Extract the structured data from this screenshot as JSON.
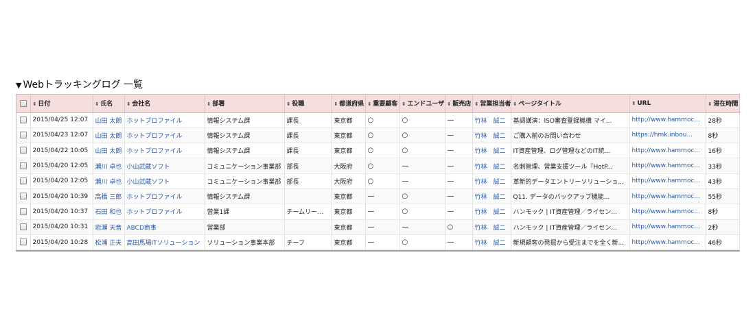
{
  "section": {
    "title": "Webトラッキングログ 一覧",
    "triangle": "▼"
  },
  "sort_glyph": "⇕",
  "columns": [
    "日付",
    "氏名",
    "会社名",
    "部署",
    "役職",
    "都道府県",
    "重要顧客",
    "エンドユーザ",
    "販売店",
    "営業担当者",
    "ページタイトル",
    "URL",
    "滞在時間"
  ],
  "rows": [
    {
      "date": "2015/04/25 12:07",
      "name": "山田 太朗",
      "company": "ホットプロファイル",
      "dept": "情報システム課",
      "title": "課長",
      "pref": "東京都",
      "important": "○",
      "enduser": "○",
      "dealer": "—",
      "rep": "竹林　誠二",
      "page": "基調講演：ISO審査登録機構 マイ...",
      "url": "http://www.hammoc...",
      "stay": "28秒"
    },
    {
      "date": "2015/04/23 12:07",
      "name": "山田 太朗",
      "company": "ホットプロファイル",
      "dept": "情報システム課",
      "title": "課長",
      "pref": "東京都",
      "important": "○",
      "enduser": "○",
      "dealer": "—",
      "rep": "竹林　誠二",
      "page": "ご購入前のお問い合わせ",
      "url": "https://hmk.inbou...",
      "stay": "8秒"
    },
    {
      "date": "2015/04/22 10:05",
      "name": "山田 太朗",
      "company": "ホットプロファイル",
      "dept": "情報システム課",
      "title": "課長",
      "pref": "東京都",
      "important": "○",
      "enduser": "○",
      "dealer": "—",
      "rep": "竹林　誠二",
      "page": "IT資産管理、ログ管理などのIT統...",
      "url": "http://www.hammoc...",
      "stay": "16秒"
    },
    {
      "date": "2015/04/20 12:05",
      "name": "瀬川 卓也",
      "company": "小山武蔵ソフト",
      "dept": "コミュニケーション事業部",
      "title": "部長",
      "pref": "大阪府",
      "important": "○",
      "enduser": "—",
      "dealer": "—",
      "rep": "竹林　誠二",
      "page": "名刺管理、営業支援ツール『HotP...",
      "url": "http://www.hammoc...",
      "stay": "33秒"
    },
    {
      "date": "2015/04/20 12:05",
      "name": "瀬川 卓也",
      "company": "小山武蔵ソフト",
      "dept": "コミュニケーション事業部",
      "title": "部長",
      "pref": "大阪府",
      "important": "○",
      "enduser": "—",
      "dealer": "—",
      "rep": "竹林　誠二",
      "page": "革新的データエントリーソリューショ...",
      "url": "http://www.hammoc...",
      "stay": "43秒"
    },
    {
      "date": "2015/04/20 10:39",
      "name": "高橋 三郎",
      "company": "ホットプロファイル",
      "dept": "情報システム課",
      "title": "",
      "pref": "東京都",
      "important": "—",
      "enduser": "○",
      "dealer": "—",
      "rep": "竹林　誠二",
      "page": "Q11. データのバックアップ機能...",
      "url": "http://www.hammoc...",
      "stay": "55秒"
    },
    {
      "date": "2015/04/20 10:37",
      "name": "石田 和也",
      "company": "ホットプロファイル",
      "dept": "営業1課",
      "title": "チームリーダー",
      "pref": "東京都",
      "important": "—",
      "enduser": "○",
      "dealer": "—",
      "rep": "竹林　誠二",
      "page": "ハンモック | IT資産管理／ライセン...",
      "url": "http://www.hammoc...",
      "stay": "8秒"
    },
    {
      "date": "2015/04/20 10:31",
      "name": "岩瀬 天音",
      "company": "ABCD商事",
      "dept": "営業部",
      "title": "",
      "pref": "東京都",
      "important": "—",
      "enduser": "—",
      "dealer": "○",
      "rep": "竹林　誠二",
      "page": "ハンモック | IT資産管理／ライセン...",
      "url": "http://www.hammoc...",
      "stay": "2秒"
    },
    {
      "date": "2015/04/20 10:28",
      "name": "松浦 正夫",
      "company": "高田馬場ITソリューション",
      "dept": "ソリューション事業本部",
      "title": "チーフ",
      "pref": "東京都",
      "important": "—",
      "enduser": "○",
      "dealer": "—",
      "rep": "竹林　誠二",
      "page": "新規顧客の発掘から受注までを全く新...",
      "url": "http://www.hammoc...",
      "stay": "46秒"
    }
  ]
}
